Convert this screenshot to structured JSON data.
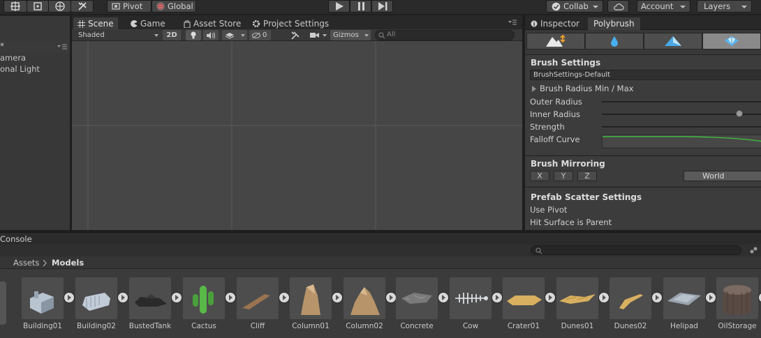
{
  "toolbar": {
    "pivot": "Pivot",
    "global": "Global",
    "collab": "Collab",
    "account": "Account",
    "layers": "Layers"
  },
  "tabs": {
    "scene": "Scene",
    "game": "Game",
    "asset_store": "Asset Store",
    "project_settings": "Project Settings",
    "inspector": "Inspector",
    "polybrush": "Polybrush"
  },
  "hierarchy": {
    "create_symbol": "*",
    "items": [
      "amera",
      "onal Light"
    ]
  },
  "scene_toolbar": {
    "shading": "Shaded",
    "mode_2d": "2D",
    "hidden_count": "0",
    "gizmos": "Gizmos",
    "search_placeholder": "All"
  },
  "polybrush": {
    "brush_settings_title": "Brush Settings",
    "preset": "BrushSettings-Default",
    "radius_min_max": "Brush Radius Min / Max",
    "outer_radius": "Outer Radius",
    "inner_radius": "Inner Radius",
    "strength": "Strength",
    "falloff_curve": "Falloff Curve",
    "mirroring_title": "Brush Mirroring",
    "mirror_x": "X",
    "mirror_y": "Y",
    "mirror_z": "Z",
    "mirror_space": "World",
    "prefab_title": "Prefab Scatter Settings",
    "use_pivot": "Use Pivot",
    "hit_surface": "Hit Surface is Parent"
  },
  "console": {
    "title": "Console"
  },
  "project": {
    "breadcrumb_root": "Assets",
    "breadcrumb_current": "Models",
    "assets": [
      "Building01",
      "Building02",
      "BustedTank",
      "Cactus",
      "Cliff",
      "Column01",
      "Column02",
      "Concrete",
      "Cow",
      "Crater01",
      "Dunes01",
      "Dunes02",
      "Helipad",
      "OilStorage"
    ]
  },
  "colors": {
    "falloff_curve": "#3dd13d",
    "active_tab": "#3e3e3e",
    "panel": "#383838"
  }
}
